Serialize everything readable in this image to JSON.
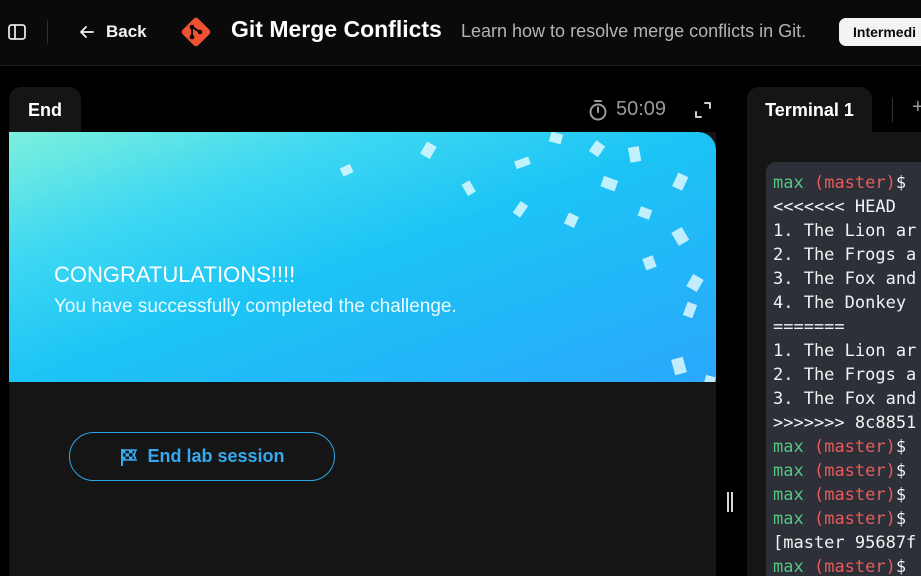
{
  "header": {
    "back_label": "Back",
    "title": "Git Merge Conflicts",
    "subtitle": "Learn how to resolve merge conflicts in Git.",
    "level_badge": "Intermedi"
  },
  "left_pane": {
    "tab_label": "End",
    "timer": "50:09",
    "congrats_title": "CONGRATULATIONS!!!!",
    "congrats_text": "You have successfully completed the challenge.",
    "end_button_label": "End lab session"
  },
  "terminal": {
    "tab_label": "Terminal 1",
    "lines": [
      {
        "type": "prompt",
        "user": "max",
        "branch": "(master)",
        "symbol": "$"
      },
      {
        "type": "text",
        "text": "<<<<<<< HEAD"
      },
      {
        "type": "text",
        "text": "1. The Lion ar"
      },
      {
        "type": "text",
        "text": "2. The Frogs a"
      },
      {
        "type": "text",
        "text": "3. The Fox and"
      },
      {
        "type": "text",
        "text": "4. The Donkey"
      },
      {
        "type": "text",
        "text": "======="
      },
      {
        "type": "text",
        "text": "1. The Lion ar"
      },
      {
        "type": "text",
        "text": "2. The Frogs a"
      },
      {
        "type": "text",
        "text": "3. The Fox and"
      },
      {
        "type": "text",
        "text": ">>>>>>> 8c8851"
      },
      {
        "type": "prompt",
        "user": "max",
        "branch": "(master)",
        "symbol": "$"
      },
      {
        "type": "prompt",
        "user": "max",
        "branch": "(master)",
        "symbol": "$"
      },
      {
        "type": "prompt",
        "user": "max",
        "branch": "(master)",
        "symbol": "$"
      },
      {
        "type": "prompt",
        "user": "max",
        "branch": "(master)",
        "symbol": "$"
      },
      {
        "type": "text",
        "text": "[master 95687f"
      },
      {
        "type": "prompt",
        "user": "max",
        "branch": "(master)",
        "symbol": "$"
      }
    ]
  },
  "icons": {
    "sidebar": "sidebar-toggle-icon",
    "back": "arrow-left-icon",
    "git": "git-logo-icon",
    "timer": "stopwatch-icon",
    "expand": "expand-icon",
    "flag": "checkered-flag-icon",
    "add_terminal": "plus-icon"
  },
  "colors": {
    "accent": "#36a9ef",
    "prompt_user": "#4ec97e",
    "prompt_branch": "#ea5a5a",
    "git_logo": "#f05133"
  }
}
